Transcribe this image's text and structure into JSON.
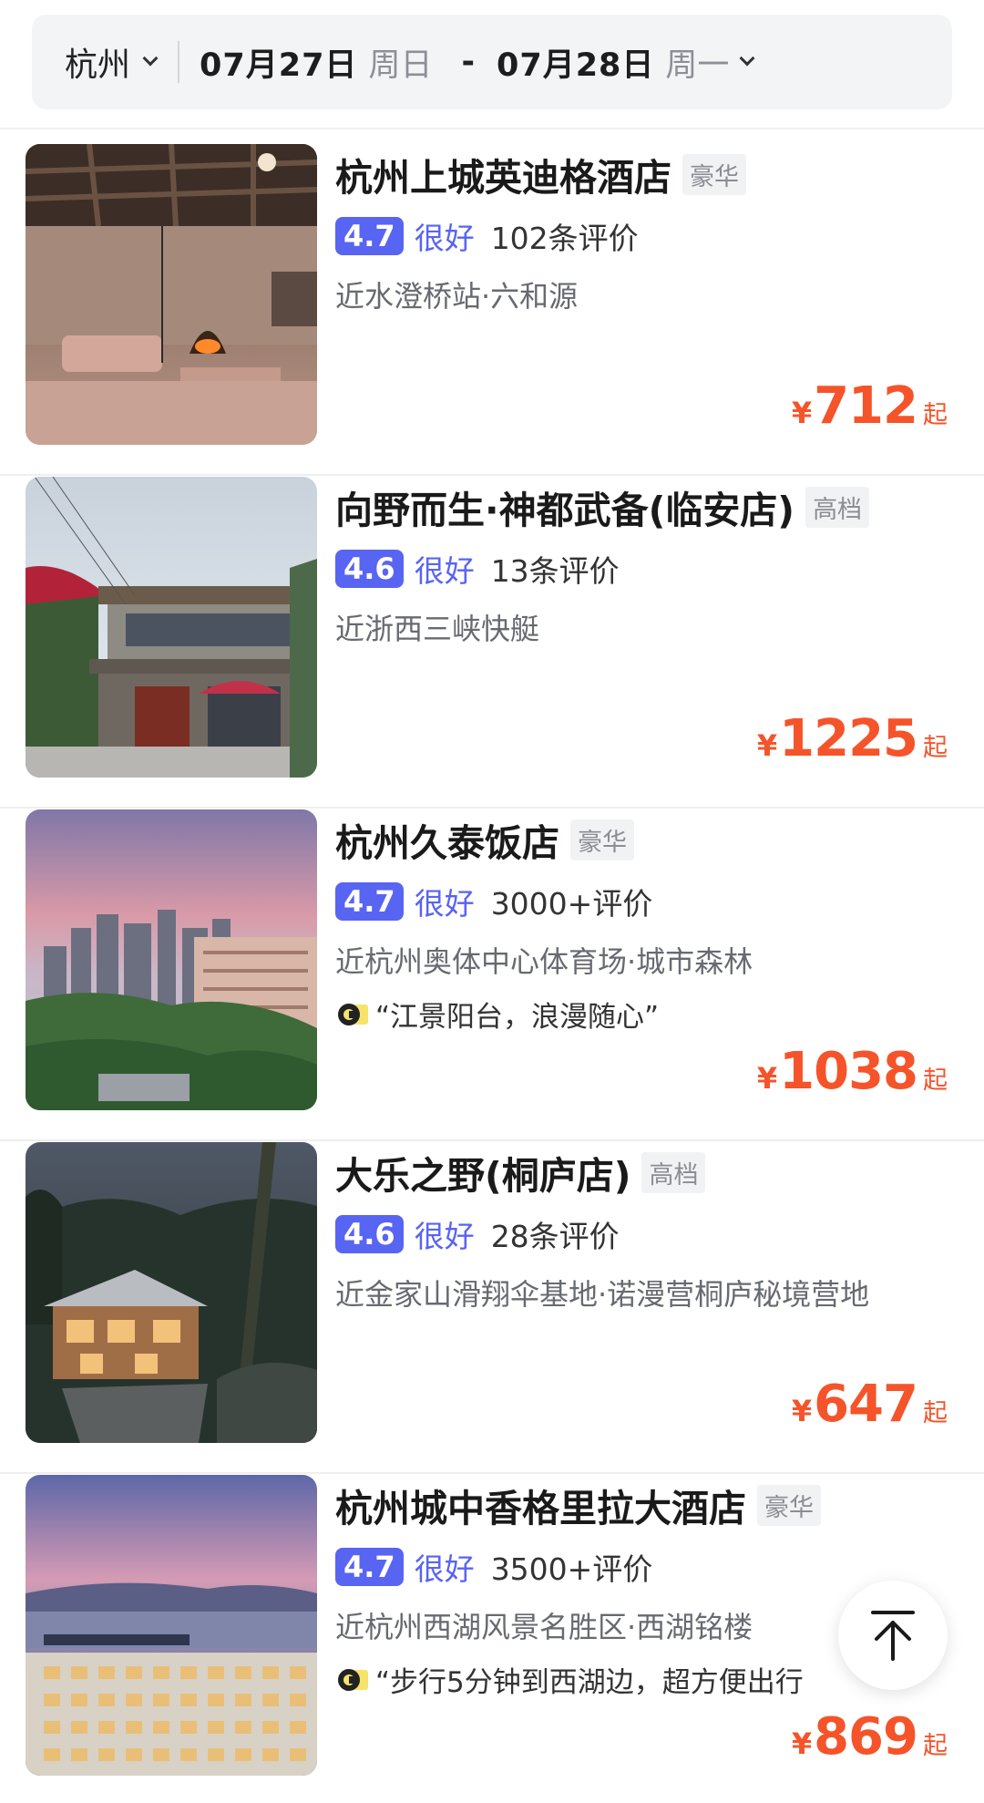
{
  "search": {
    "city": "杭州",
    "check_in_date": "07月27日",
    "check_in_weekday": "周日",
    "separator": "-",
    "check_out_date": "07月28日",
    "check_out_weekday": "周一"
  },
  "hotels": [
    {
      "name": "杭州上城英迪格酒店",
      "grade": "豪华",
      "score": "4.7",
      "level": "很好",
      "reviews": "102条评价",
      "location": "近水澄桥站·六和源",
      "quote": "",
      "currency": "¥",
      "price": "712",
      "price_suffix": "起"
    },
    {
      "name": "向野而生·神都武备(临安店)",
      "grade": "高档",
      "score": "4.6",
      "level": "很好",
      "reviews": "13条评价",
      "location": "近浙西三峡快艇",
      "quote": "",
      "currency": "¥",
      "price": "1225",
      "price_suffix": "起"
    },
    {
      "name": "杭州久泰饭店",
      "grade": "豪华",
      "score": "4.7",
      "level": "很好",
      "reviews": "3000+评价",
      "location": "近杭州奥体中心体育场·城市森林",
      "quote": "“江景阳台，浪漫随心”",
      "currency": "¥",
      "price": "1038",
      "price_suffix": "起"
    },
    {
      "name": "大乐之野(桐庐店)",
      "grade": "高档",
      "score": "4.6",
      "level": "很好",
      "reviews": "28条评价",
      "location": "近金家山滑翔伞基地·诺漫营桐庐秘境营地",
      "quote": "",
      "currency": "¥",
      "price": "647",
      "price_suffix": "起"
    },
    {
      "name": "杭州城中香格里拉大酒店",
      "grade": "豪华",
      "score": "4.7",
      "level": "很好",
      "reviews": "3500+评价",
      "location": "近杭州西湖风景名胜区·西湖铭楼",
      "quote": "“步行5分钟到西湖边，超方便出行",
      "currency": "¥",
      "price": "869",
      "price_suffix": "起"
    }
  ],
  "colors": {
    "accent": "#5864f2",
    "price": "#f5542a"
  },
  "icons": {
    "back_to_top": "arrow-up-icon",
    "quote": "quote-badge-icon",
    "dropdown": "chevron-down-icon"
  }
}
